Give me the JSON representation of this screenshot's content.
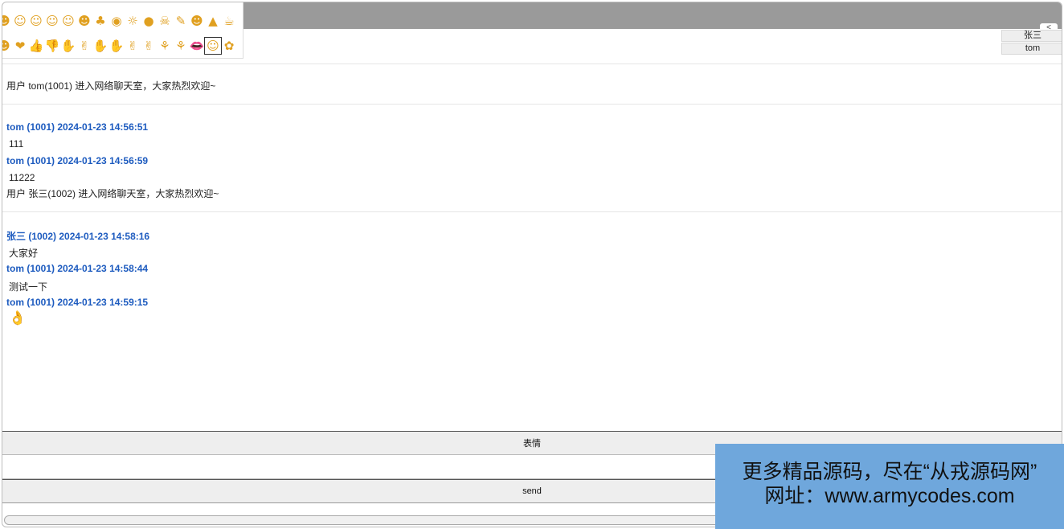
{
  "window": {
    "collapse_glyph": "<"
  },
  "emoji_panel": {
    "row1": [
      "☻",
      "☺",
      "☺",
      "☺",
      "☺",
      "☻",
      "♣",
      "◉",
      "☼",
      "●",
      "☠",
      "✎",
      "☻",
      "▲",
      "☕"
    ],
    "row2": [
      "☻",
      "❤",
      "👍",
      "👎",
      "✋",
      "✌",
      "✋",
      "✋",
      "✌",
      "✌",
      "⚘",
      "⚘",
      "👄",
      "☺",
      "✿"
    ],
    "selected_index_row2": 13
  },
  "users": [
    "张三",
    "tom"
  ],
  "chat": {
    "entries": [
      {
        "type": "system",
        "text": "用户 tom(1001) 进入网络聊天室，大家热烈欢迎~"
      },
      {
        "type": "message",
        "header": "tom (1001)  2024-01-23 14:56:51",
        "body": "111"
      },
      {
        "type": "message",
        "header": "tom (1001)  2024-01-23 14:56:59",
        "body": "11222"
      },
      {
        "type": "system",
        "text": "用户 张三(1002) 进入网络聊天室，大家热烈欢迎~"
      },
      {
        "type": "message",
        "header": "张三 (1002)  2024-01-23 14:58:16",
        "body": "大家好"
      },
      {
        "type": "message",
        "header": "tom (1001)  2024-01-23 14:58:44",
        "body": "测试一下"
      },
      {
        "type": "message",
        "header": "tom (1001)  2024-01-23 14:59:15",
        "body": "👌"
      }
    ]
  },
  "controls": {
    "emoji_button_label": "表情",
    "message_input_value": "",
    "send_button_label": "send"
  },
  "watermark": {
    "line1": "更多精品源码，尽在“从戎源码网”",
    "line2": "网址：www.armycodes.com"
  }
}
